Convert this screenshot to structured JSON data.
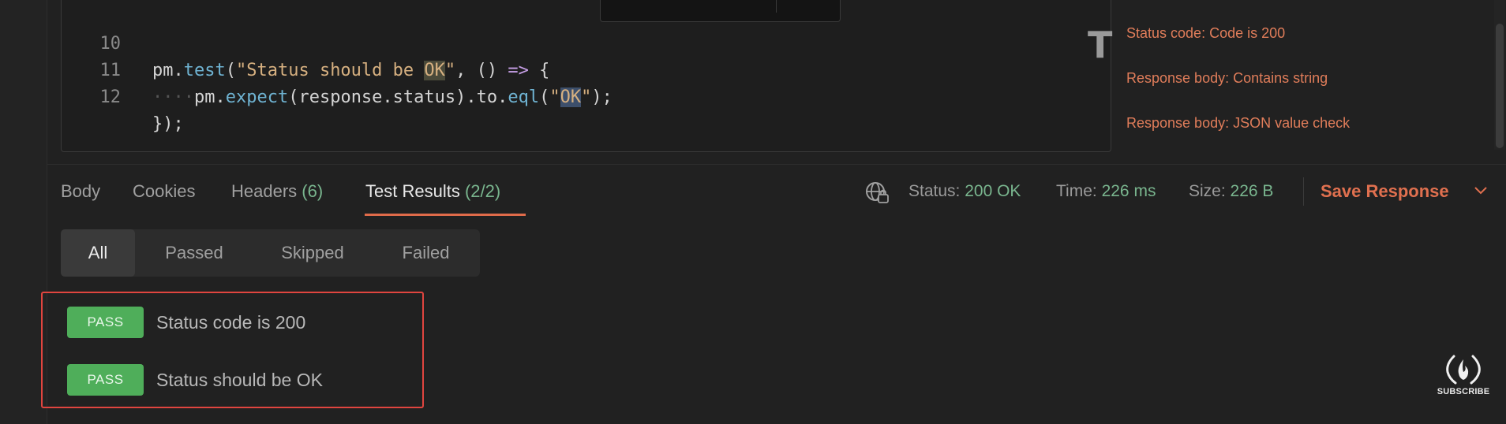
{
  "editor": {
    "lines": [
      {
        "number": "10",
        "tokens": [
          {
            "text": "pm",
            "kind": "obj"
          },
          {
            "text": ".",
            "kind": "obj"
          },
          {
            "text": "test",
            "kind": "fn"
          },
          {
            "text": "(",
            "kind": "obj"
          },
          {
            "text": "\"Status should be ",
            "kind": "str"
          },
          {
            "text": "OK",
            "kind": "str-hl"
          },
          {
            "text": "\"",
            "kind": "str"
          },
          {
            "text": ", () ",
            "kind": "obj"
          },
          {
            "text": "=>",
            "kind": "op"
          },
          {
            "text": " {",
            "kind": "obj"
          }
        ]
      },
      {
        "number": "11",
        "indent": "····",
        "tokens": [
          {
            "text": "pm",
            "kind": "obj"
          },
          {
            "text": ".",
            "kind": "obj"
          },
          {
            "text": "expect",
            "kind": "fn"
          },
          {
            "text": "(response.status).to.",
            "kind": "obj"
          },
          {
            "text": "eql",
            "kind": "fn"
          },
          {
            "text": "(",
            "kind": "obj"
          },
          {
            "text": "\"",
            "kind": "str"
          },
          {
            "text": "OK",
            "kind": "str-cur"
          },
          {
            "text": "\"",
            "kind": "str"
          },
          {
            "text": ");",
            "kind": "obj"
          }
        ]
      },
      {
        "number": "12",
        "tokens": [
          {
            "text": "});",
            "kind": "obj"
          }
        ]
      }
    ]
  },
  "snippets": [
    "Status code: Code is 200",
    "Response body: Contains string",
    "Response body: JSON value check"
  ],
  "response_tabs": [
    {
      "label": "Body",
      "count": ""
    },
    {
      "label": "Cookies",
      "count": ""
    },
    {
      "label": "Headers",
      "count": "(6)"
    },
    {
      "label": "Test Results",
      "count": "(2/2)",
      "active": true
    }
  ],
  "status_bar": {
    "status_label": "Status:",
    "status_value": "200 OK",
    "time_label": "Time:",
    "time_value": "226 ms",
    "size_label": "Size:",
    "size_value": "226 B",
    "save_label": "Save Response"
  },
  "filters": [
    {
      "label": "All",
      "active": true
    },
    {
      "label": "Passed"
    },
    {
      "label": "Skipped"
    },
    {
      "label": "Failed"
    }
  ],
  "results": [
    {
      "badge": "PASS",
      "name": "Status code is 200"
    },
    {
      "badge": "PASS",
      "name": "Status should be OK"
    }
  ],
  "watermark": {
    "label": "SUBSCRIBE"
  },
  "colors": {
    "accent": "#e06b4a",
    "pass": "#4fae5a",
    "status_ok": "#79b58e",
    "highlight_box": "#e0453f"
  }
}
